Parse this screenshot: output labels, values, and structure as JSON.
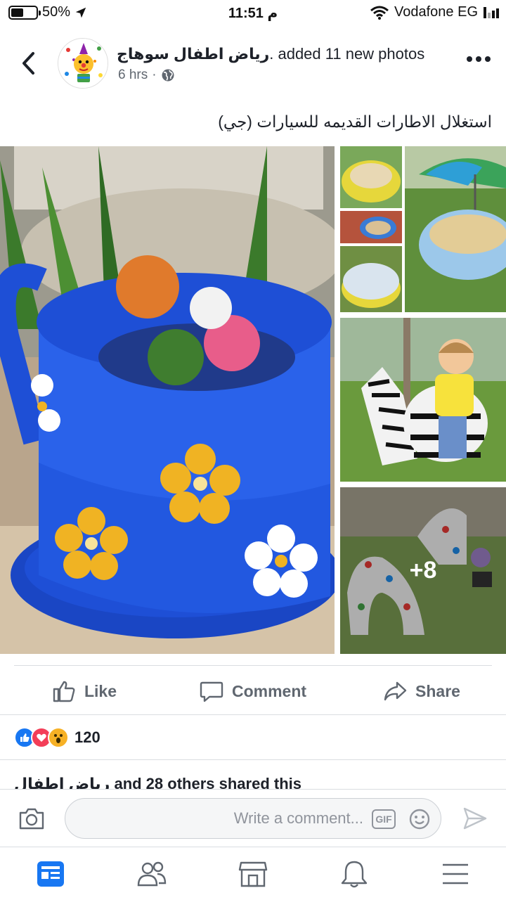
{
  "status_bar": {
    "battery_text": "50%",
    "battery_level": 0.5,
    "time": "11:51 م",
    "carrier": "Vodafone EG"
  },
  "post": {
    "page_name": "رياض اطفال سوهاج",
    "action_text": ". added 11 new photos",
    "time_ago": "6 hrs",
    "privacy_separator": "·",
    "caption": "استغلال الاطارات القديمه  للسيارات (جي)",
    "more_photos_label": "+8"
  },
  "actions": {
    "like_label": "Like",
    "comment_label": "Comment",
    "share_label": "Share"
  },
  "reactions": {
    "count": "120",
    "types": [
      "like-icon",
      "love-icon",
      "wow-icon"
    ]
  },
  "shared_text": "رياض اطفال and 28 others shared this",
  "comment_bar": {
    "placeholder": "Write a comment...",
    "gif_label": "GIF"
  },
  "bottom_nav": [
    "news-feed-icon",
    "friends-icon",
    "marketplace-icon",
    "notifications-icon",
    "menu-icon"
  ],
  "colors": {
    "facebook_blue": "#1877f2",
    "tire_blue": "#1e4fd6",
    "flower_yellow": "#f0b323",
    "text_grey": "#606770"
  }
}
